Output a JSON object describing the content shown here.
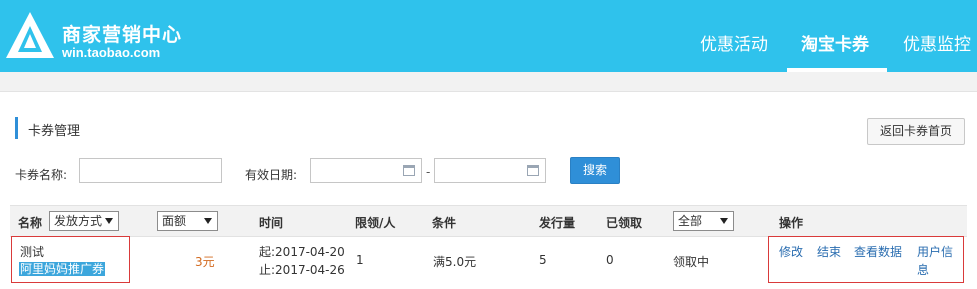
{
  "header": {
    "brand_title": "商家营销中心",
    "brand_url": "win.taobao.com",
    "tabs": [
      {
        "label": "优惠活动"
      },
      {
        "label": "淘宝卡券"
      },
      {
        "label": "优惠监控"
      }
    ],
    "active_tab": "淘宝卡券"
  },
  "section": {
    "title": "卡券管理",
    "back_button": "返回卡券首页"
  },
  "filters": {
    "name_label": "卡券名称:",
    "name_value": "",
    "date_label": "有效日期:",
    "date_start": "",
    "date_end": "",
    "date_separator": "-",
    "search_button": "搜索"
  },
  "table": {
    "headers": {
      "name": "名称",
      "issue_method": "发放方式",
      "amount": "面额",
      "time": "时间",
      "limit": "限领/人",
      "condition": "条件",
      "issued": "发行量",
      "received": "已领取",
      "status_filter": "全部",
      "actions": "操作"
    },
    "rows": [
      {
        "name": "测试",
        "tag": "阿里妈妈推广券",
        "amount": "3元",
        "start": "起:2017-04-20",
        "end": "止:2017-04-26",
        "limit": "1",
        "condition": "满5.0元",
        "issued": "5",
        "received": "0",
        "status": "领取中",
        "actions": [
          "修改",
          "结束",
          "查看数据",
          "用户信息"
        ]
      }
    ]
  },
  "colors": {
    "header_bg": "#2fc2ec",
    "link": "#2a6db0",
    "primary_button": "#2f8fd8",
    "highlight_red": "#d93a3a",
    "amount": "#d2691e"
  },
  "icons": [
    "logo-icon",
    "calendar-icon",
    "dropdown-caret-icon"
  ]
}
